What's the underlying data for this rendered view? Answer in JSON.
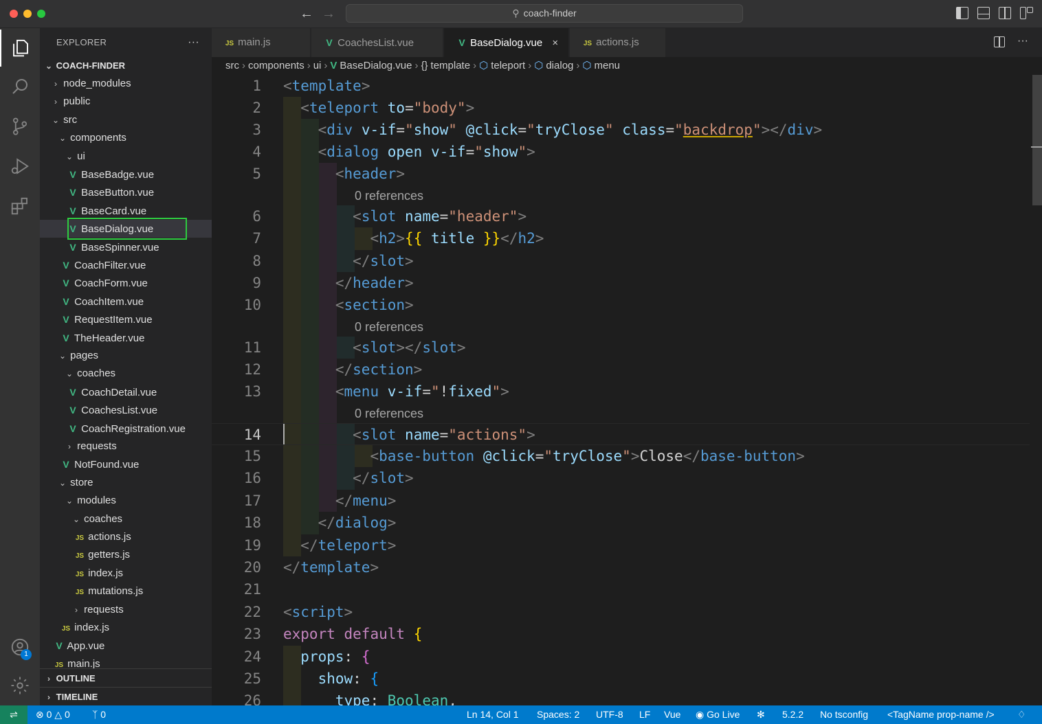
{
  "window": {
    "search_label": "coach-finder"
  },
  "explorer": {
    "title": "EXPLORER",
    "more": "···",
    "project": "COACH-FINDER",
    "items": [
      {
        "label": "node_modules",
        "kind": "folder-closed"
      },
      {
        "label": "public",
        "kind": "folder-closed"
      },
      {
        "label": "src",
        "kind": "folder-open"
      },
      {
        "label": "components",
        "kind": "folder-open"
      },
      {
        "label": "ui",
        "kind": "folder-open"
      },
      {
        "label": "BaseBadge.vue",
        "kind": "vue"
      },
      {
        "label": "BaseButton.vue",
        "kind": "vue"
      },
      {
        "label": "BaseCard.vue",
        "kind": "vue"
      },
      {
        "label": "BaseDialog.vue",
        "kind": "vue"
      },
      {
        "label": "BaseSpinner.vue",
        "kind": "vue"
      },
      {
        "label": "CoachFilter.vue",
        "kind": "vue"
      },
      {
        "label": "CoachForm.vue",
        "kind": "vue"
      },
      {
        "label": "CoachItem.vue",
        "kind": "vue"
      },
      {
        "label": "RequestItem.vue",
        "kind": "vue"
      },
      {
        "label": "TheHeader.vue",
        "kind": "vue"
      },
      {
        "label": "pages",
        "kind": "folder-open"
      },
      {
        "label": "coaches",
        "kind": "folder-open"
      },
      {
        "label": "CoachDetail.vue",
        "kind": "vue"
      },
      {
        "label": "CoachesList.vue",
        "kind": "vue"
      },
      {
        "label": "CoachRegistration.vue",
        "kind": "vue"
      },
      {
        "label": "requests",
        "kind": "folder-closed"
      },
      {
        "label": "NotFound.vue",
        "kind": "vue"
      },
      {
        "label": "store",
        "kind": "folder-open"
      },
      {
        "label": "modules",
        "kind": "folder-open"
      },
      {
        "label": "coaches",
        "kind": "folder-open"
      },
      {
        "label": "actions.js",
        "kind": "js"
      },
      {
        "label": "getters.js",
        "kind": "js"
      },
      {
        "label": "index.js",
        "kind": "js"
      },
      {
        "label": "mutations.js",
        "kind": "js"
      },
      {
        "label": "requests",
        "kind": "folder-closed"
      },
      {
        "label": "index.js",
        "kind": "js"
      },
      {
        "label": "App.vue",
        "kind": "vue"
      },
      {
        "label": "main.js",
        "kind": "js"
      }
    ],
    "outline": "OUTLINE",
    "timeline": "TIMELINE"
  },
  "tabs": [
    {
      "label": "main.js",
      "icon": "JS"
    },
    {
      "label": "CoachesList.vue",
      "icon": "V"
    },
    {
      "label": "BaseDialog.vue",
      "icon": "V",
      "active": true
    },
    {
      "label": "actions.js",
      "icon": "JS"
    }
  ],
  "tab_close": "×",
  "breadcrumb": {
    "parts": [
      "src",
      "components",
      "ui",
      "BaseDialog.vue",
      "template",
      "teleport",
      "dialog",
      "menu"
    ]
  },
  "codelens": "0 references",
  "line_numbers": [
    "1",
    "2",
    "3",
    "4",
    "5",
    "6",
    "7",
    "8",
    "9",
    "10",
    "11",
    "12",
    "13",
    "14",
    "15",
    "16",
    "17",
    "18",
    "19",
    "20",
    "21",
    "22",
    "23",
    "24",
    "25",
    "26"
  ],
  "status": {
    "errors": "0",
    "warnings": "0",
    "ports": "0",
    "position": "Ln 14, Col 1",
    "spaces": "Spaces: 2",
    "encoding": "UTF-8",
    "eol": "LF",
    "language": "Vue",
    "golive": "Go Live",
    "version": "5.2.2",
    "tsconfig": "No tsconfig",
    "tagname": "<TagName prop-name />"
  },
  "colors": {
    "accent": "#007acc",
    "vue": "#41b883",
    "js": "#cbcb41",
    "highlight_box": "#2ecc40"
  },
  "icons": [
    "explorer-icon",
    "search-icon",
    "source-control-icon",
    "run-debug-icon",
    "extensions-icon",
    "account-icon",
    "settings-icon"
  ]
}
